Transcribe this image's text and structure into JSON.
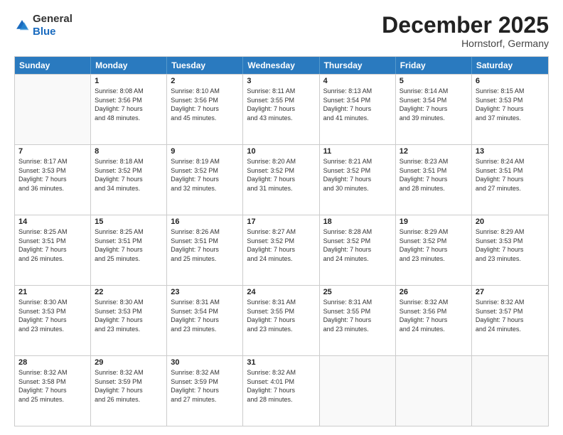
{
  "header": {
    "logo_line1": "General",
    "logo_line2": "Blue",
    "month": "December 2025",
    "location": "Hornstorf, Germany"
  },
  "days": [
    "Sunday",
    "Monday",
    "Tuesday",
    "Wednesday",
    "Thursday",
    "Friday",
    "Saturday"
  ],
  "weeks": [
    [
      {
        "date": "",
        "info": ""
      },
      {
        "date": "1",
        "info": "Sunrise: 8:08 AM\nSunset: 3:56 PM\nDaylight: 7 hours\nand 48 minutes."
      },
      {
        "date": "2",
        "info": "Sunrise: 8:10 AM\nSunset: 3:56 PM\nDaylight: 7 hours\nand 45 minutes."
      },
      {
        "date": "3",
        "info": "Sunrise: 8:11 AM\nSunset: 3:55 PM\nDaylight: 7 hours\nand 43 minutes."
      },
      {
        "date": "4",
        "info": "Sunrise: 8:13 AM\nSunset: 3:54 PM\nDaylight: 7 hours\nand 41 minutes."
      },
      {
        "date": "5",
        "info": "Sunrise: 8:14 AM\nSunset: 3:54 PM\nDaylight: 7 hours\nand 39 minutes."
      },
      {
        "date": "6",
        "info": "Sunrise: 8:15 AM\nSunset: 3:53 PM\nDaylight: 7 hours\nand 37 minutes."
      }
    ],
    [
      {
        "date": "7",
        "info": "Sunrise: 8:17 AM\nSunset: 3:53 PM\nDaylight: 7 hours\nand 36 minutes."
      },
      {
        "date": "8",
        "info": "Sunrise: 8:18 AM\nSunset: 3:52 PM\nDaylight: 7 hours\nand 34 minutes."
      },
      {
        "date": "9",
        "info": "Sunrise: 8:19 AM\nSunset: 3:52 PM\nDaylight: 7 hours\nand 32 minutes."
      },
      {
        "date": "10",
        "info": "Sunrise: 8:20 AM\nSunset: 3:52 PM\nDaylight: 7 hours\nand 31 minutes."
      },
      {
        "date": "11",
        "info": "Sunrise: 8:21 AM\nSunset: 3:52 PM\nDaylight: 7 hours\nand 30 minutes."
      },
      {
        "date": "12",
        "info": "Sunrise: 8:23 AM\nSunset: 3:51 PM\nDaylight: 7 hours\nand 28 minutes."
      },
      {
        "date": "13",
        "info": "Sunrise: 8:24 AM\nSunset: 3:51 PM\nDaylight: 7 hours\nand 27 minutes."
      }
    ],
    [
      {
        "date": "14",
        "info": "Sunrise: 8:25 AM\nSunset: 3:51 PM\nDaylight: 7 hours\nand 26 minutes."
      },
      {
        "date": "15",
        "info": "Sunrise: 8:25 AM\nSunset: 3:51 PM\nDaylight: 7 hours\nand 25 minutes."
      },
      {
        "date": "16",
        "info": "Sunrise: 8:26 AM\nSunset: 3:51 PM\nDaylight: 7 hours\nand 25 minutes."
      },
      {
        "date": "17",
        "info": "Sunrise: 8:27 AM\nSunset: 3:52 PM\nDaylight: 7 hours\nand 24 minutes."
      },
      {
        "date": "18",
        "info": "Sunrise: 8:28 AM\nSunset: 3:52 PM\nDaylight: 7 hours\nand 24 minutes."
      },
      {
        "date": "19",
        "info": "Sunrise: 8:29 AM\nSunset: 3:52 PM\nDaylight: 7 hours\nand 23 minutes."
      },
      {
        "date": "20",
        "info": "Sunrise: 8:29 AM\nSunset: 3:53 PM\nDaylight: 7 hours\nand 23 minutes."
      }
    ],
    [
      {
        "date": "21",
        "info": "Sunrise: 8:30 AM\nSunset: 3:53 PM\nDaylight: 7 hours\nand 23 minutes."
      },
      {
        "date": "22",
        "info": "Sunrise: 8:30 AM\nSunset: 3:53 PM\nDaylight: 7 hours\nand 23 minutes."
      },
      {
        "date": "23",
        "info": "Sunrise: 8:31 AM\nSunset: 3:54 PM\nDaylight: 7 hours\nand 23 minutes."
      },
      {
        "date": "24",
        "info": "Sunrise: 8:31 AM\nSunset: 3:55 PM\nDaylight: 7 hours\nand 23 minutes."
      },
      {
        "date": "25",
        "info": "Sunrise: 8:31 AM\nSunset: 3:55 PM\nDaylight: 7 hours\nand 23 minutes."
      },
      {
        "date": "26",
        "info": "Sunrise: 8:32 AM\nSunset: 3:56 PM\nDaylight: 7 hours\nand 24 minutes."
      },
      {
        "date": "27",
        "info": "Sunrise: 8:32 AM\nSunset: 3:57 PM\nDaylight: 7 hours\nand 24 minutes."
      }
    ],
    [
      {
        "date": "28",
        "info": "Sunrise: 8:32 AM\nSunset: 3:58 PM\nDaylight: 7 hours\nand 25 minutes."
      },
      {
        "date": "29",
        "info": "Sunrise: 8:32 AM\nSunset: 3:59 PM\nDaylight: 7 hours\nand 26 minutes."
      },
      {
        "date": "30",
        "info": "Sunrise: 8:32 AM\nSunset: 3:59 PM\nDaylight: 7 hours\nand 27 minutes."
      },
      {
        "date": "31",
        "info": "Sunrise: 8:32 AM\nSunset: 4:01 PM\nDaylight: 7 hours\nand 28 minutes."
      },
      {
        "date": "",
        "info": ""
      },
      {
        "date": "",
        "info": ""
      },
      {
        "date": "",
        "info": ""
      }
    ]
  ]
}
